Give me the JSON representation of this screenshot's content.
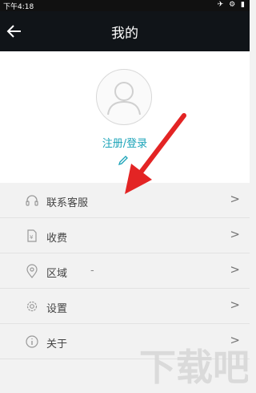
{
  "status_bar": {
    "time": "下午4:18",
    "icons": "✈ ⚙ ▮"
  },
  "header": {
    "title": "我的"
  },
  "profile": {
    "login_label": "注册/登录"
  },
  "menu": [
    {
      "label": "联系客服",
      "icon": "headset-icon",
      "arrow": ">"
    },
    {
      "label": "收费",
      "icon": "fee-icon",
      "arrow": ">"
    },
    {
      "label": "区域",
      "sub": "-",
      "icon": "location-icon",
      "arrow": ">"
    },
    {
      "label": "设置",
      "icon": "gear-icon",
      "arrow": ">"
    },
    {
      "label": "关于",
      "icon": "info-icon",
      "arrow": ">"
    }
  ],
  "watermark": {
    "text": "下载吧"
  }
}
